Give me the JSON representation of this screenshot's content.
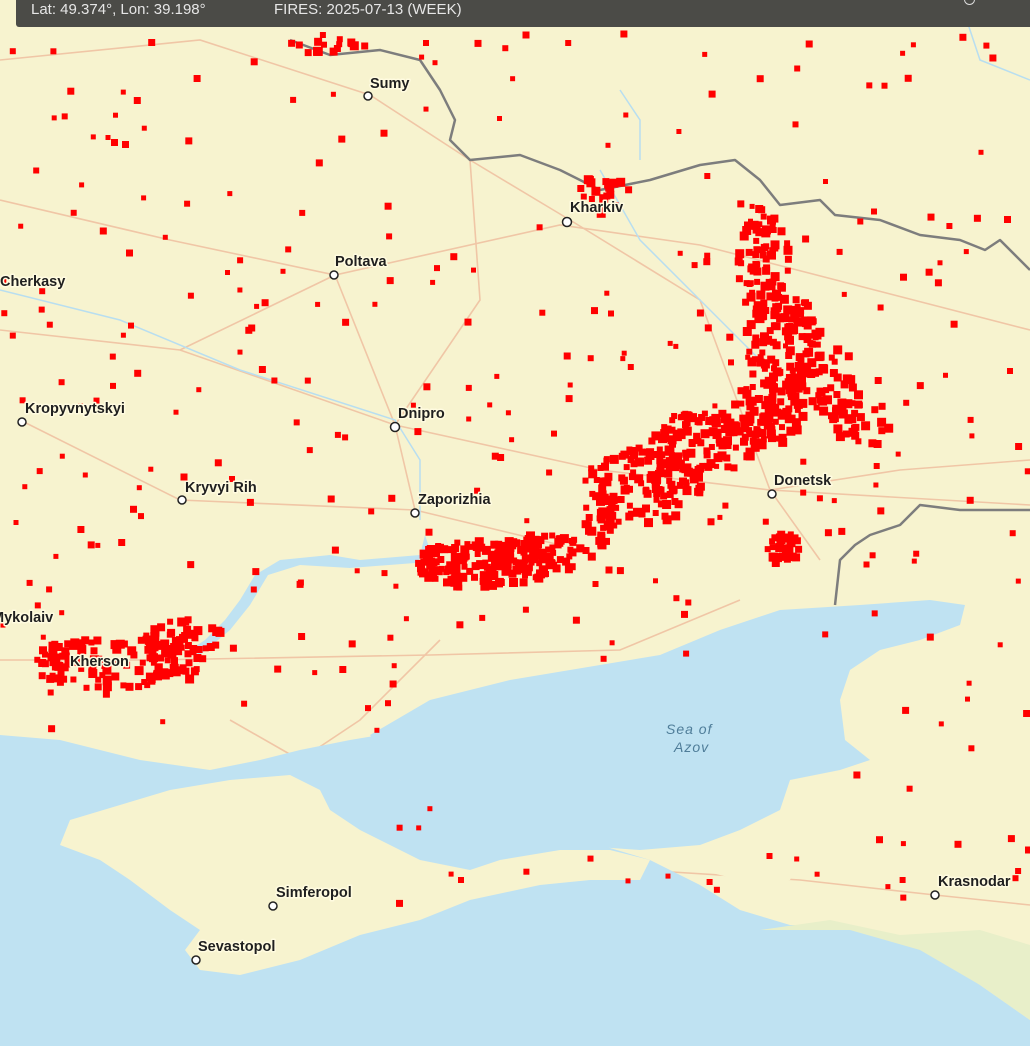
{
  "status": {
    "coords": "Lat: 49.374°, Lon: 39.198°",
    "fires": "FIRES: 2025-07-13 (WEEK)"
  },
  "map": {
    "cities": [
      "Sumy",
      "Kharkiv",
      "Poltava",
      "Cherkasy",
      "Kropyvnytskyi",
      "Dnipro",
      "Kryvyi Rih",
      "Zaporizhia",
      "Donetsk",
      "Mykolaiv",
      "Kherson",
      "Simferopol",
      "Sevastopol",
      "Krasnodar"
    ],
    "sea_label_line1": "Sea of",
    "sea_label_line2": "Azov"
  },
  "colors": {
    "land": "#f7f3cf",
    "water": "#bfe2f2",
    "fire": "#ff0000",
    "border": "#7a7a7a",
    "roads": "#f2c7a5",
    "status_bg": "#4b4b47"
  },
  "icons": [
    "fire-cluster-icon",
    "city-marker-icon"
  ]
}
